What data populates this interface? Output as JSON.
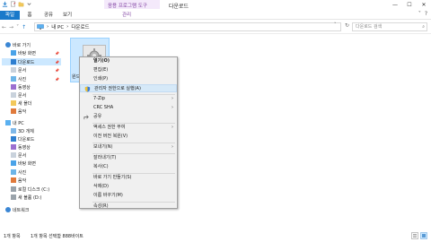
{
  "window": {
    "title": "다운로드",
    "context_tab_group": "응용 프로그램 도구",
    "controls": [
      "—",
      "☐",
      "✕"
    ]
  },
  "ribbon": {
    "tabs": [
      "파일",
      "홈",
      "공유",
      "보기"
    ],
    "context_tab": "관리",
    "right_icons": [
      "˅",
      "?"
    ]
  },
  "address": {
    "back": "←",
    "forward": "→",
    "recent": "˅",
    "up": "↑",
    "path": [
      "내 PC",
      "다운로드"
    ],
    "separator": "›",
    "dropdown": "˅",
    "refresh": "↻",
    "search_placeholder": "다운로드 검색",
    "search_icon": "⌕"
  },
  "nav": {
    "items": [
      {
        "label": "바로 가기",
        "icon": "star-icon"
      },
      {
        "label": "바탕 화면",
        "icon": "desktop-icon",
        "pinned": true
      },
      {
        "label": "다운로드",
        "icon": "download-icon",
        "pinned": true,
        "selected": true
      },
      {
        "label": "문서",
        "icon": "document-icon",
        "pinned": true
      },
      {
        "label": "사진",
        "icon": "pictures-icon",
        "pinned": true
      },
      {
        "label": "동영상",
        "icon": "video-icon"
      },
      {
        "label": "문서",
        "icon": "document-icon"
      },
      {
        "label": "새 폴더",
        "icon": "folder-icon"
      },
      {
        "label": "음악",
        "icon": "music-icon"
      },
      {
        "label": "내 PC",
        "icon": "pc-icon"
      },
      {
        "label": "3D 개체",
        "icon": "3d-objects-icon"
      },
      {
        "label": "다운로드",
        "icon": "download-icon"
      },
      {
        "label": "동영상",
        "icon": "video-icon"
      },
      {
        "label": "문서",
        "icon": "document-icon"
      },
      {
        "label": "바탕 화면",
        "icon": "desktop-icon"
      },
      {
        "label": "사진",
        "icon": "pictures-icon"
      },
      {
        "label": "음악",
        "icon": "music-icon"
      },
      {
        "label": "로컬 디스크 (C:)",
        "icon": "drive-icon"
      },
      {
        "label": "새 볼륨 (D:)",
        "icon": "drive-icon"
      },
      {
        "label": "네트워크",
        "icon": "network-icon"
      }
    ],
    "pin_glyph": "📌"
  },
  "file": {
    "label": "원드",
    "icon": "setup-gear-icon"
  },
  "context_menu": {
    "items": [
      {
        "label": "열기(O)",
        "bold": true
      },
      {
        "label": "편집(E)"
      },
      {
        "label": "인쇄(P)"
      },
      {
        "label": "관리자 권한으로 실행(A)",
        "icon": "shield-icon",
        "highlighted": true
      },
      {
        "label": "7-Zip",
        "submenu": true
      },
      {
        "label": "CRC SHA",
        "submenu": true
      },
      {
        "label": "공유",
        "icon": "share-icon"
      },
      {
        "label": "액세스 권한 부여",
        "submenu": true
      },
      {
        "label": "이전 버전 복원(V)"
      },
      {
        "label": "보내기(N)",
        "submenu": true
      },
      {
        "label": "잘라내기(T)"
      },
      {
        "label": "복사(C)"
      },
      {
        "label": "바로 가기 만들기(S)"
      },
      {
        "label": "삭제(D)"
      },
      {
        "label": "이름 바꾸기(M)"
      },
      {
        "label": "속성(R)"
      }
    ],
    "submenu_arrow": "›"
  },
  "status": {
    "count": "1개 항목",
    "selection": "1개 항목 선택함 888바이트"
  },
  "colors": {
    "accent": "#1979ca",
    "selection": "#cce8ff",
    "context_purple": "#7d3ea0"
  }
}
